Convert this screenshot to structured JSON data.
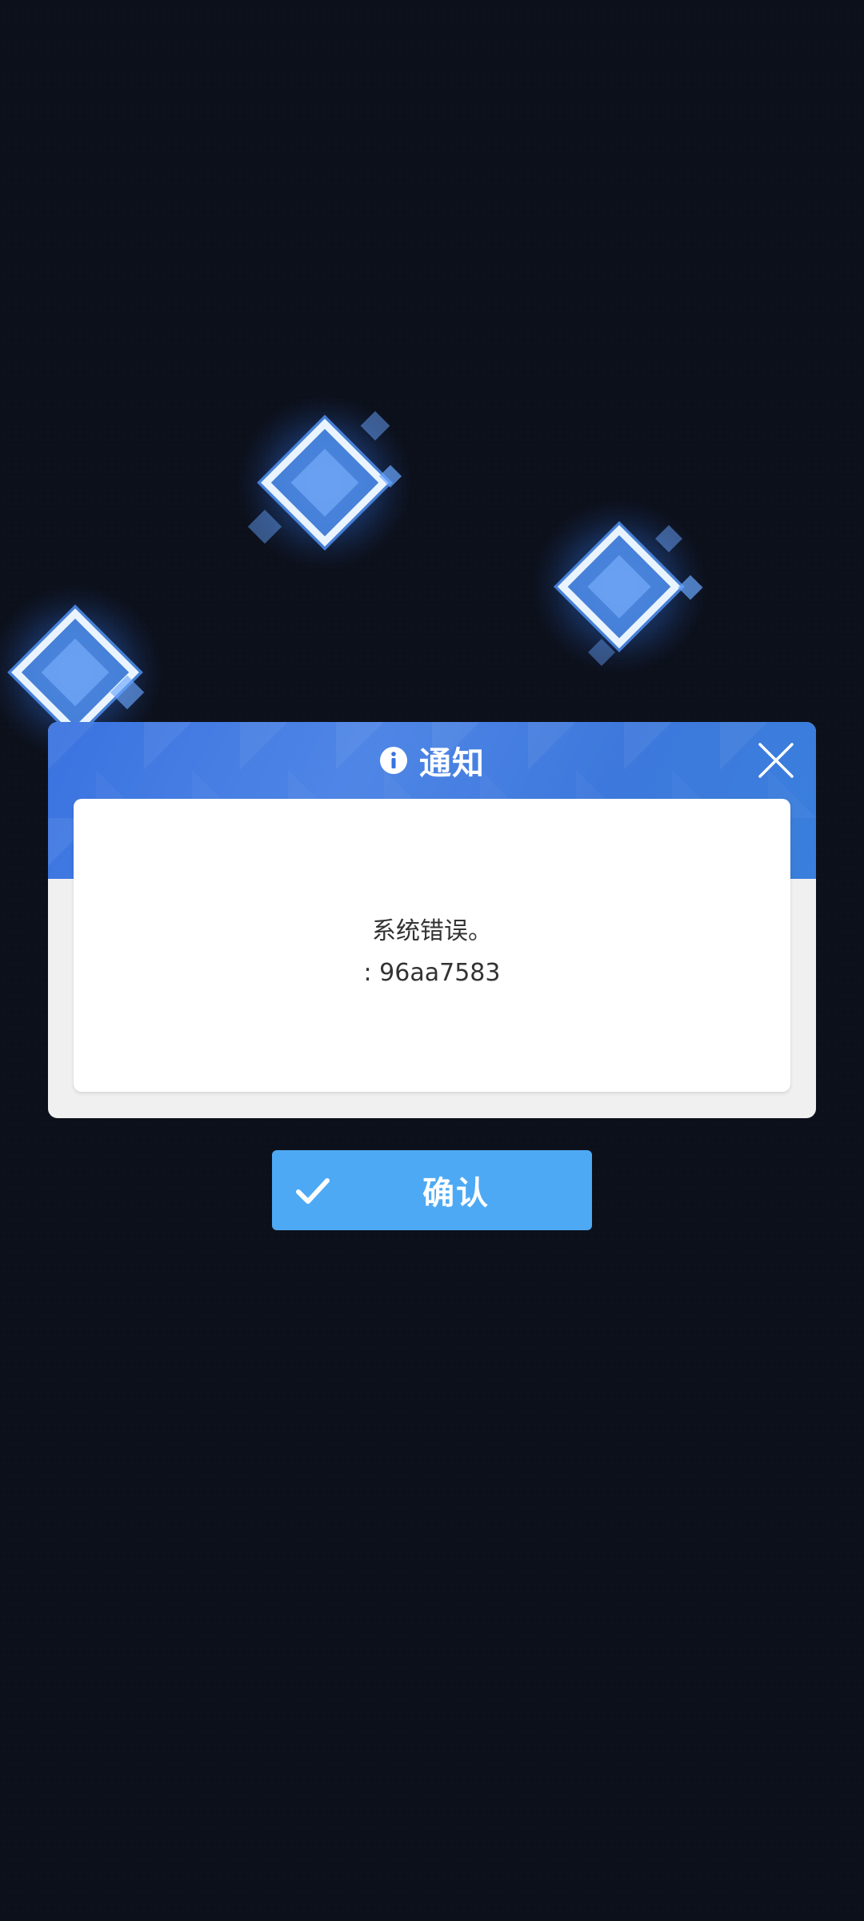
{
  "dialog": {
    "title": "通知",
    "message_line1": "系统错误。",
    "message_line2": ": 96aa7583"
  },
  "confirm_button": {
    "label": "确认"
  },
  "colors": {
    "background": "#0c101b",
    "header_blue": "#3a73e0",
    "confirm_blue": "#4ea9f4",
    "gem_glow": "#5aa0ff"
  },
  "icons": {
    "title_icon": "info-icon",
    "close_icon": "close-icon",
    "confirm_icon": "check-icon",
    "decorations": [
      "diamond-gem-icon",
      "diamond-gem-icon",
      "diamond-gem-icon"
    ]
  }
}
